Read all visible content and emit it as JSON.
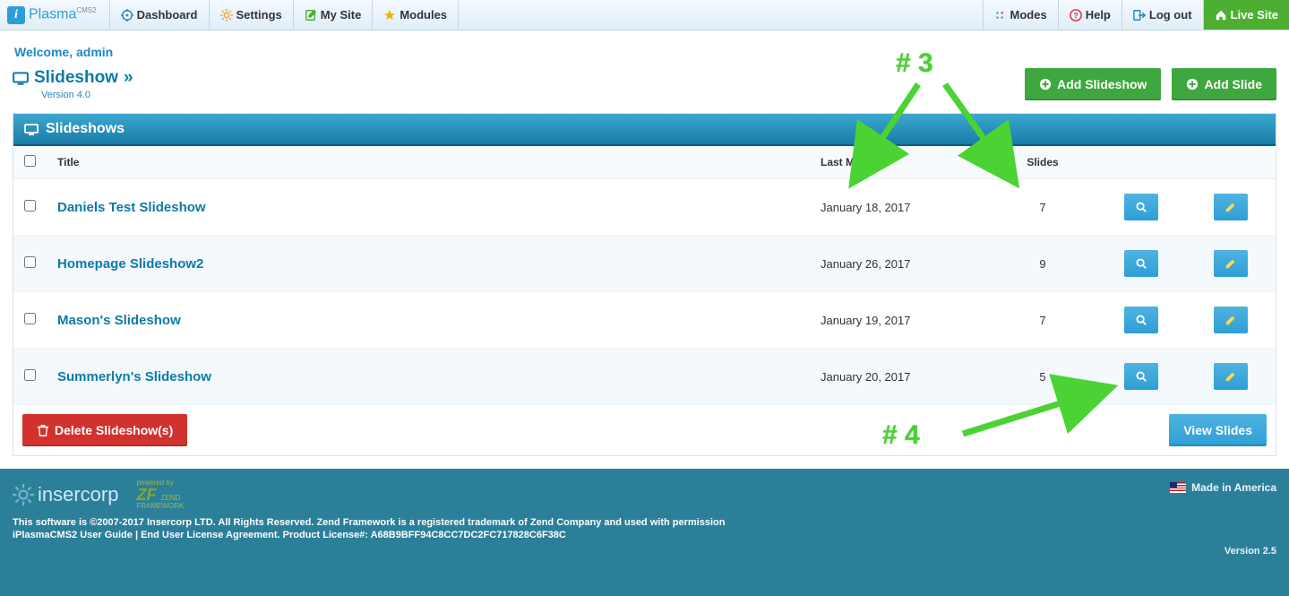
{
  "logo": {
    "brand": "Plasma",
    "sub": "CMS2"
  },
  "nav": {
    "dashboard": "Dashboard",
    "settings": "Settings",
    "mysite": "My Site",
    "modules": "Modules",
    "modes": "Modes",
    "help": "Help",
    "logout": "Log out",
    "livesite": "Live Site"
  },
  "welcome": "Welcome, admin",
  "module": {
    "title": "Slideshow",
    "chevron": "»",
    "version": "Version 4.0",
    "add_slideshow": "Add Slideshow",
    "add_slide": "Add Slide"
  },
  "panel": {
    "title": "Slideshows",
    "columns": {
      "title": "Title",
      "modified": "Last Modified",
      "slides": "Slides"
    },
    "rows": [
      {
        "title": "Daniels Test Slideshow",
        "modified": "January 18, 2017",
        "slides": "7"
      },
      {
        "title": "Homepage Slideshow2",
        "modified": "January 26, 2017",
        "slides": "9"
      },
      {
        "title": "Mason's Slideshow",
        "modified": "January 19, 2017",
        "slides": "7"
      },
      {
        "title": "Summerlyn's Slideshow",
        "modified": "January 20, 2017",
        "slides": "5"
      }
    ],
    "delete": "Delete Slideshow(s)",
    "view": "View Slides"
  },
  "footer": {
    "insercorp": "insercorp",
    "zf_powered": "powered by",
    "zf_brand": "ZEND",
    "zf_sub": "FRAMEWORK",
    "line1": "This software is ©2007-2017 Insercorp LTD. All Rights Reserved. Zend Framework is a registered trademark of Zend Company and used with permission",
    "line2": "iPlasmaCMS2 User Guide | End User License Agreement. Product License#: A68B9BFF94C8CC7DC2FC717828C6F38C",
    "made": "Made in America",
    "version": "Version 2.5"
  },
  "annotations": {
    "a3": "# 3",
    "a4": "# 4"
  }
}
